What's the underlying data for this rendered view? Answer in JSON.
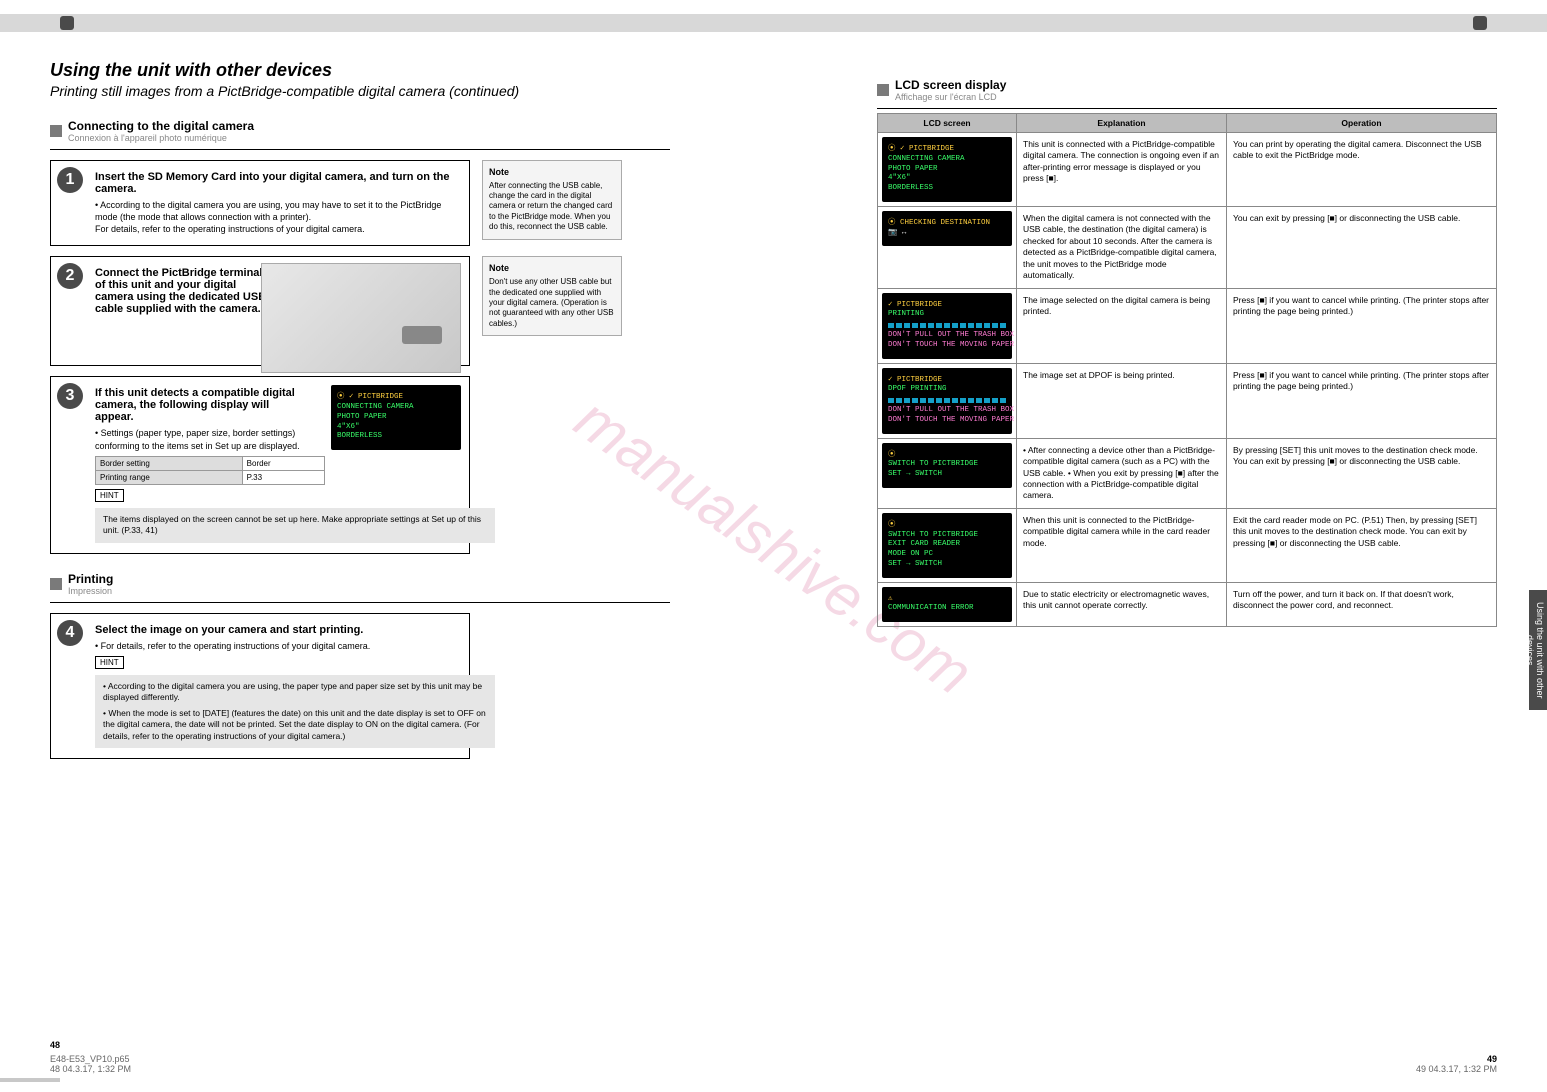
{
  "watermark": "manualshive.com",
  "side_tab": "Using the unit with other devices",
  "left": {
    "header_title": "Using the unit with other devices",
    "header_sub": "Printing still images from a PictBridge-compatible digital camera (continued)",
    "sec_connect": {
      "title": "Connecting to the digital camera",
      "subtitle": "Connexion à l'appareil photo numérique",
      "step1": {
        "num": "1",
        "title": "Insert the SD Memory Card into your digital camera, and turn on the camera.",
        "body1": "• According to the digital camera you are using, you may have to set it to the PictBridge mode (the mode that allows connection with a printer).",
        "body2": "For details, refer to the operating instructions of your digital camera.",
        "note_title": "Note",
        "note_body": "After connecting the USB cable, change the card in the digital camera or return the changed card to the PictBridge mode. When you do this, reconnect the USB cable."
      },
      "step2": {
        "num": "2",
        "title": "Connect the PictBridge terminal of this unit and your digital camera using the dedicated USB cable supplied with the camera.",
        "note_title": "Note",
        "note_body": "Don't use any other USB cable but the dedicated one supplied with your digital camera. (Operation is not guaranteed with any other USB cables.)"
      },
      "step3": {
        "num": "3",
        "title": "If this unit detects a compatible digital camera, the following display will appear.",
        "body": "• Settings (paper type, paper size, border settings) conforming to the items set in Set up are displayed.",
        "table": {
          "r1c1": "Border setting",
          "r1c2": "Border",
          "r2c1": "Printing range",
          "r2c2": "P.33"
        },
        "hint_btn": "HINT",
        "hint_text": "The items displayed on the screen cannot be set up here. Make appropriate settings at Set up of this unit. (P.33, 41)",
        "lcd": {
          "l1": "⦿ ✓ PICTBRIDGE",
          "l2": "CONNECTING CAMERA",
          "l3": "PHOTO PAPER",
          "l4": "4\"X6\"",
          "l5": "BORDERLESS"
        }
      },
      "sec_print": {
        "title": "Printing",
        "subtitle": "Impression",
        "step4": {
          "num": "4",
          "title": "Select the image on your camera and start printing.",
          "body": "• For details, refer to the operating instructions of your digital camera.",
          "hint_btn": "HINT",
          "grey1": "• According to the digital camera you are using, the paper type and paper size set by this unit may be displayed differently.",
          "grey2": "• When the mode is set to [DATE] (features the date) on this unit and the date display is set to OFF on the digital camera, the date will not be printed. Set the date display to ON on the digital camera. (For details, refer to the operating instructions of your digital camera.)"
        }
      }
    },
    "footer_page": "48",
    "footer_file": "E48-E53_VP10.p65",
    "footer_meta": "48                                   04.3.17, 1:32 PM"
  },
  "right": {
    "sec_title": "LCD screen display",
    "sec_sub": "Affichage sur l'écran LCD",
    "th1": "LCD screen",
    "th2": "Explanation",
    "th3": "Operation",
    "rows": [
      {
        "lcd": [
          "⦿ ✓ PICTBRIDGE",
          "CONNECTING CAMERA",
          "PHOTO PAPER",
          "4\"X6\"",
          "BORDERLESS"
        ],
        "desc": "This unit is connected with a PictBridge-compatible digital camera. The connection is ongoing even if an after-printing error message is displayed or you press [■].",
        "op": "You can print by operating the digital camera. Disconnect the USB cable to exit the PictBridge mode."
      },
      {
        "lcd_special": "checking",
        "lcd": [
          "⦿ CHECKING DESTINATION"
        ],
        "desc": "When the digital camera is not connected with the USB cable, the destination (the digital camera) is checked for about 10 seconds. After the camera is detected as a PictBridge-compatible digital camera, the unit moves to the PictBridge mode automatically.",
        "op": "You can exit by pressing [■] or disconnecting the USB cable."
      },
      {
        "lcd_special": "printing",
        "lcd": [
          "✓ PICTBRIDGE",
          "PRINTING",
          "",
          "",
          "DON'T PULL OUT THE TRASH BOX",
          "DON'T TOUCH THE MOVING PAPER"
        ],
        "desc": "The image selected on the digital camera is being printed.",
        "op": "Press [■] if you want to cancel while printing. (The printer stops after printing the page being printed.)"
      },
      {
        "lcd_special": "dpof",
        "lcd": [
          "✓ PICTBRIDGE",
          "DPOF PRINTING",
          "",
          "",
          "DON'T PULL OUT THE TRASH BOX",
          "DON'T TOUCH THE MOVING PAPER"
        ],
        "desc": "The image set at DPOF is being printed.",
        "op": "Press [■] if you want to cancel while printing. (The printer stops after printing the page being printed.)"
      },
      {
        "lcd_special": "switch1",
        "lcd": [
          "⦿",
          "SWITCH TO PICTBRIDGE",
          "",
          "SET → SWITCH"
        ],
        "desc": "• After connecting a device other than a PictBridge-compatible digital camera (such as a PC) with the USB cable.\n• When you exit by pressing [■] after the connection with a PictBridge-compatible digital camera.",
        "op": "By pressing [SET] this unit moves to the destination check mode.\nYou can exit by pressing [■] or disconnecting the USB cable."
      },
      {
        "lcd_special": "switch2",
        "lcd": [
          "⦿",
          "SWITCH TO PICTBRIDGE",
          "EXIT CARD READER",
          " MODE ON PC",
          "SET → SWITCH"
        ],
        "desc": "When this unit is connected to the PictBridge-compatible digital camera while in the card reader mode.",
        "op": "Exit the card reader mode on PC. (P.51)\nThen, by pressing [SET] this unit moves to the destination check mode.\nYou can exit by pressing [■] or disconnecting the USB cable."
      },
      {
        "lcd_special": "error",
        "lcd": [
          "⚠",
          "COMMUNICATION ERROR"
        ],
        "desc": "Due to static electricity or electromagnetic waves, this unit cannot operate correctly.",
        "op": "Turn off the power, and turn it back on. If that doesn't work, disconnect the power cord, and reconnect."
      }
    ],
    "footer_page": "49",
    "footer_meta": "49                                   04.3.17, 1:32 PM"
  }
}
